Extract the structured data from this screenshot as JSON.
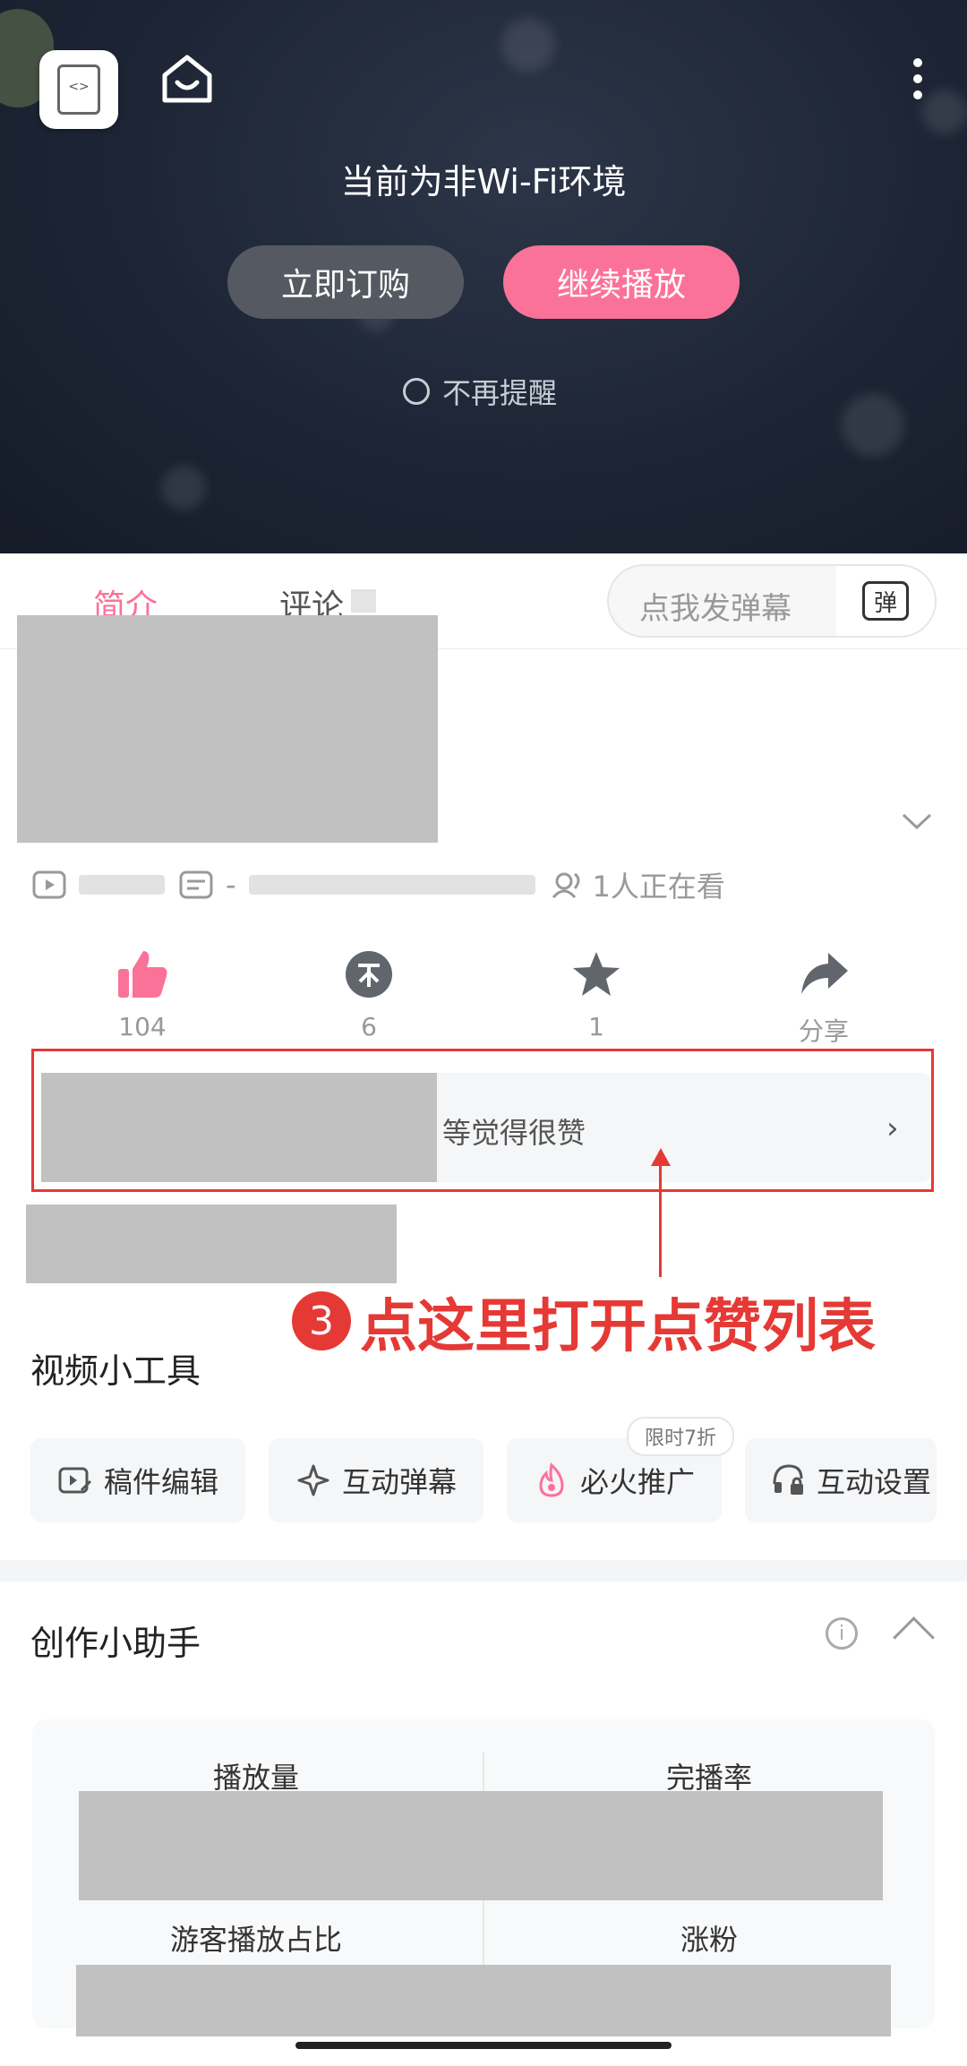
{
  "video": {
    "network_notice": "当前为非Wi-Fi环境",
    "buy_label": "立即订购",
    "continue_label": "继续播放",
    "no_remind_label": "不再提醒"
  },
  "tabs": {
    "intro": "简介",
    "comment": "评论"
  },
  "danmaku": {
    "placeholder": "点我发弹幕",
    "button_glyph": "弹"
  },
  "meta": {
    "separator": "-",
    "watching": "1人正在看"
  },
  "actions": [
    {
      "name": "like",
      "count": "104"
    },
    {
      "name": "coin",
      "count": "6"
    },
    {
      "name": "favorite",
      "count": "1"
    },
    {
      "name": "share",
      "label": "分享"
    }
  ],
  "like_list": {
    "text": "等觉得很赞",
    "chevron": "›"
  },
  "annotation": {
    "number": "3",
    "text": "点这里打开点赞列表"
  },
  "tools": {
    "title": "视频小工具",
    "items": [
      "稿件编辑",
      "互动弹幕",
      "必火推广",
      "互动设置"
    ],
    "promo_tag": "限时7折"
  },
  "assistant": {
    "title": "创作小助手",
    "info": "i",
    "stats": [
      "播放量",
      "完播率",
      "游客播放占比",
      "涨粉"
    ]
  },
  "colors": {
    "accent": "#fb7299",
    "annotation": "#e53935"
  }
}
